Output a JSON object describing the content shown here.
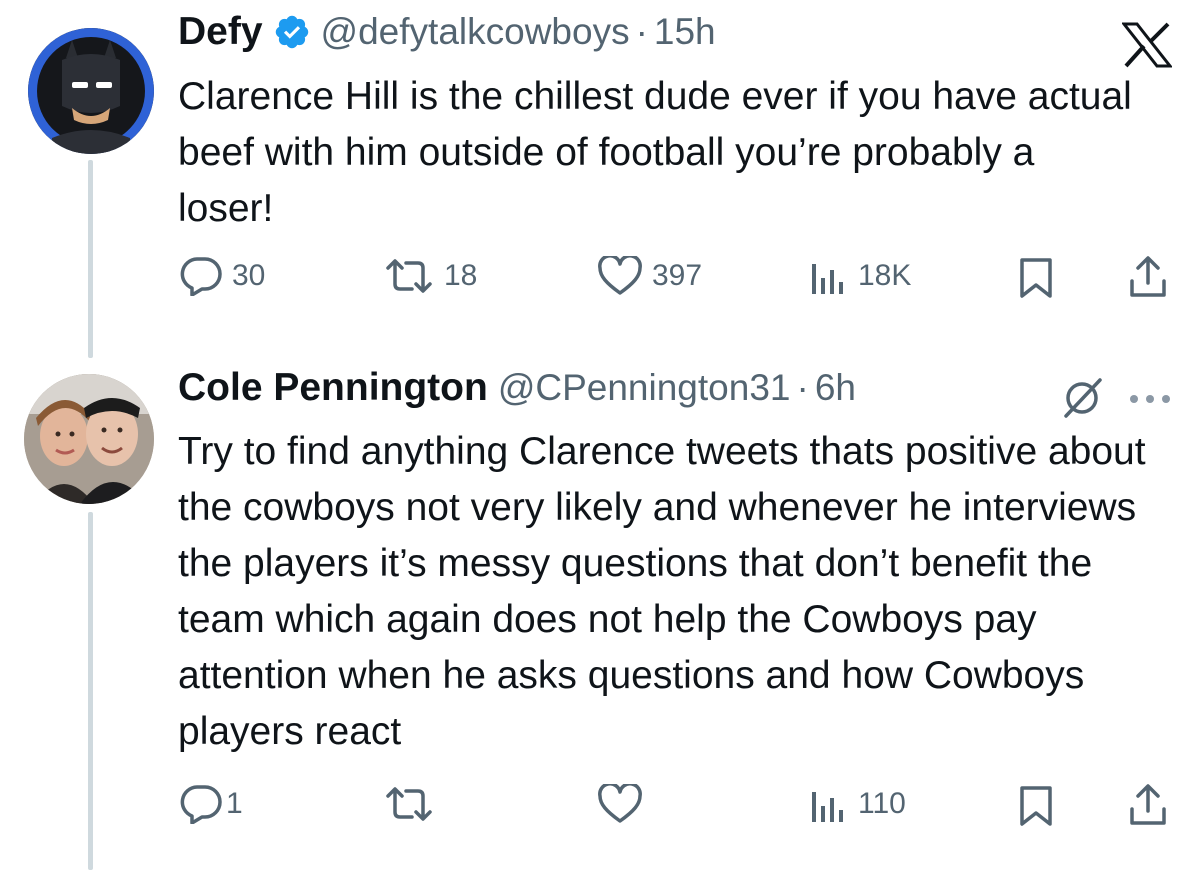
{
  "tweet1": {
    "name": "Defy",
    "handle": "@defytalkcowboys",
    "separator": "·",
    "time": "15h",
    "text": "Clarence Hill is the chillest dude ever if you have actual beef with him outside of football you’re probably a loser!",
    "replies": "30",
    "retweets": "18",
    "likes": "397",
    "views": "18K"
  },
  "tweet2": {
    "name": "Cole Pennington",
    "handle": "@CPennington31",
    "separator": "·",
    "time": "6h",
    "text": "Try to find anything Clarence tweets thats positive about the cowboys not very likely and whenever he interviews the players it’s messy questions that don’t benefit the team which again does not help the Cowboys pay attention when he asks questions and how Cowboys players react",
    "replies": "1",
    "retweets": "",
    "likes": "",
    "views": "110"
  },
  "colors": {
    "text": "#0f1419",
    "secondary": "#536471",
    "verified": "#1d9bf0",
    "thread_line": "#cfd9de"
  },
  "icons": {
    "brand": "x-logo-icon",
    "verified": "verified-badge-icon",
    "reply": "reply-icon",
    "retweet": "retweet-icon",
    "like": "heart-icon",
    "views": "views-icon",
    "bookmark": "bookmark-icon",
    "share": "share-icon",
    "grok": "grok-icon",
    "more": "more-icon"
  }
}
